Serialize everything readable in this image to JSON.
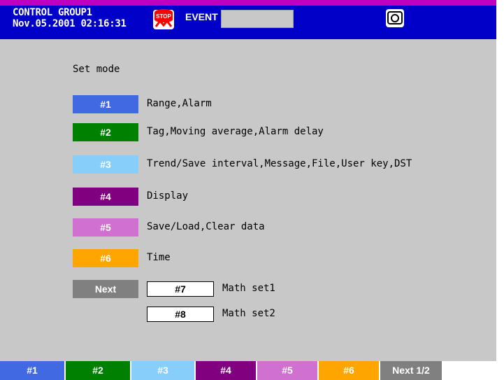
{
  "header": {
    "group": "CONTROL GROUP1",
    "datetime": "Nov.05.2001 02:16:31",
    "stop_icon": "stop-icon",
    "event_label": "EVENT",
    "event_value": "",
    "camera_icon": "camera-icon"
  },
  "main": {
    "title": "Set mode",
    "items": [
      {
        "key": "#1",
        "label": "Range,Alarm",
        "color": "#4169e1"
      },
      {
        "key": "#2",
        "label": "Tag,Moving average,Alarm delay",
        "color": "#008000"
      },
      {
        "key": "#3",
        "label": "Trend/Save interval,Message,File,User key,DST",
        "color": "#87cefa"
      },
      {
        "key": "#4",
        "label": "Display",
        "color": "#800080"
      },
      {
        "key": "#5",
        "label": "Save/Load,Clear data",
        "color": "#d070d0"
      },
      {
        "key": "#6",
        "label": "Time",
        "color": "#ffa500"
      }
    ],
    "next": {
      "key": "Next",
      "color": "#808080"
    },
    "sub_items": [
      {
        "key": "#7",
        "label": "Math set1"
      },
      {
        "key": "#8",
        "label": "Math set2"
      }
    ]
  },
  "footer": {
    "keys": [
      {
        "label": "#1",
        "color": "#4169e1"
      },
      {
        "label": "#2",
        "color": "#008000"
      },
      {
        "label": "#3",
        "color": "#87cefa"
      },
      {
        "label": "#4",
        "color": "#800080"
      },
      {
        "label": "#5",
        "color": "#d070d0"
      },
      {
        "label": "#6",
        "color": "#ffa500"
      },
      {
        "label": "Next 1/2",
        "color": "#808080"
      }
    ]
  }
}
